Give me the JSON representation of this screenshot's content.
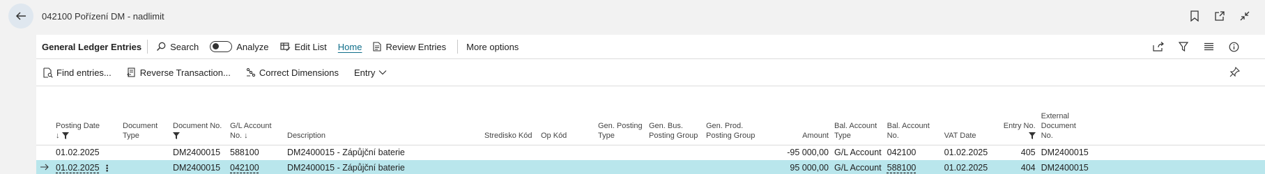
{
  "window": {
    "title": "042100 Pořízení DM - nadlimit"
  },
  "actions": {
    "page_name": "General Ledger Entries",
    "search": "Search",
    "analyze": "Analyze",
    "edit_list": "Edit List",
    "home": "Home",
    "review_entries": "Review Entries",
    "more_options": "More options"
  },
  "subactions": {
    "find_entries": "Find entries...",
    "reverse_transaction": "Reverse Transaction...",
    "correct_dimensions": "Correct Dimensions",
    "entry": "Entry"
  },
  "table": {
    "headers": {
      "posting_date": "Posting Date",
      "document_type_1": "Document",
      "document_type_2": "Type",
      "document_no": "Document No.",
      "gl_account_1": "G/L Account",
      "gl_account_2": "No. ↓",
      "description": "Description",
      "stredisko": "Stredisko Kód",
      "op_kod": "Op Kód",
      "gen_posting_1": "Gen. Posting",
      "gen_posting_2": "Type",
      "gen_bus_1": "Gen. Bus.",
      "gen_bus_2": "Posting Group",
      "gen_prod_1": "Gen. Prod.",
      "gen_prod_2": "Posting Group",
      "amount": "Amount",
      "bal_type_1": "Bal. Account",
      "bal_type_2": "Type",
      "bal_no_1": "Bal. Account",
      "bal_no_2": "No.",
      "vat_date": "VAT Date",
      "entry_no": "Entry No.",
      "ext_doc_1": "External",
      "ext_doc_2": "Document",
      "ext_doc_3": "No."
    },
    "rows": [
      {
        "posting_date": "01.02.2025",
        "document_type": "",
        "document_no": "DM2400015",
        "gl_account_no": "588100",
        "description": "DM2400015 - Zápůjční baterie",
        "stredisko": "",
        "op_kod": "",
        "gen_posting_type": "",
        "gen_bus_group": "",
        "gen_prod_group": "",
        "amount": "-95 000,00",
        "bal_account_type": "G/L Account",
        "bal_account_no": "042100",
        "vat_date": "01.02.2025",
        "entry_no": "405",
        "external_doc_no": "DM2400015"
      },
      {
        "posting_date": "01.02.2025",
        "document_type": "",
        "document_no": "DM2400015",
        "gl_account_no": "042100",
        "description": "DM2400015 - Zápůjční baterie",
        "stredisko": "",
        "op_kod": "",
        "gen_posting_type": "",
        "gen_bus_group": "",
        "gen_prod_group": "",
        "amount": "95 000,00",
        "bal_account_type": "G/L Account",
        "bal_account_no": "588100",
        "vat_date": "01.02.2025",
        "entry_no": "404",
        "external_doc_no": "DM2400015"
      }
    ]
  },
  "colors": {
    "accent": "#0f6e8a",
    "selected_row": "#b9e6ec"
  }
}
